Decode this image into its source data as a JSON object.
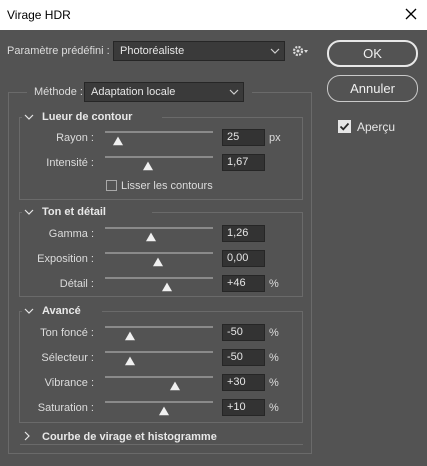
{
  "window": {
    "title": "Virage HDR"
  },
  "preset": {
    "label": "Paramètre prédéfini :",
    "value": "Photoréaliste"
  },
  "buttons": {
    "ok": "OK",
    "cancel": "Annuler"
  },
  "preview": {
    "label": "Aperçu",
    "checked": true
  },
  "method": {
    "label": "Méthode :",
    "value": "Adaptation locale"
  },
  "sections": {
    "glow": {
      "title": "Lueur de contour",
      "rows": [
        {
          "label": "Rayon :",
          "value": "25",
          "unit": "px"
        },
        {
          "label": "Intensité :",
          "value": "1,67",
          "unit": ""
        }
      ],
      "smooth_edges": {
        "label": "Lisser les contours",
        "checked": false
      }
    },
    "tone": {
      "title": "Ton et détail",
      "rows": [
        {
          "label": "Gamma :",
          "value": "1,26",
          "unit": ""
        },
        {
          "label": "Exposition :",
          "value": "0,00",
          "unit": ""
        },
        {
          "label": "Détail :",
          "value": "+46",
          "unit": "%"
        }
      ]
    },
    "advanced": {
      "title": "Avancé",
      "rows": [
        {
          "label": "Ton foncé :",
          "value": "-50",
          "unit": "%"
        },
        {
          "label": "Sélecteur :",
          "value": "-50",
          "unit": "%"
        },
        {
          "label": "Vibrance :",
          "value": "+30",
          "unit": "%"
        },
        {
          "label": "Saturation :",
          "value": "+10",
          "unit": "%"
        }
      ]
    },
    "curve": {
      "title": "Courbe de virage et histogramme"
    }
  },
  "colors": {
    "background": "#535353",
    "field": "#333333",
    "border": "#6a6a6a"
  }
}
